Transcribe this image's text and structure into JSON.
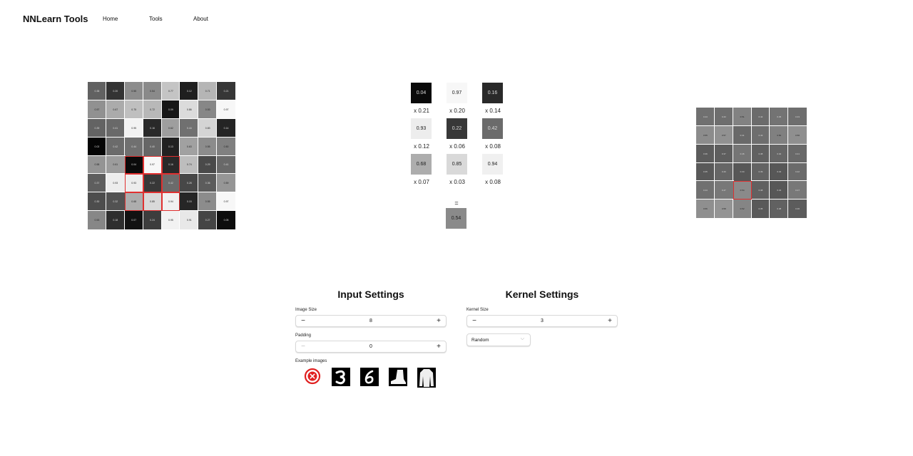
{
  "nav": {
    "brand": "NNLearn Tools",
    "links": [
      "Home",
      "Tools",
      "About"
    ]
  },
  "input_image": {
    "size": 8,
    "values": [
      [
        0.38,
        0.2,
        0.55,
        0.54,
        0.77,
        0.12,
        0.71,
        0.21
      ],
      [
        0.57,
        0.67,
        0.75,
        0.72,
        0.09,
        0.86,
        0.53,
        0.97
      ],
      [
        0.39,
        0.41,
        0.95,
        0.16,
        0.62,
        0.44,
        0.83,
        0.14
      ],
      [
        0.02,
        0.42,
        0.44,
        0.4,
        0.13,
        0.63,
        0.55,
        0.5
      ],
      [
        0.58,
        0.61,
        0.04,
        0.97,
        0.16,
        0.74,
        0.29,
        0.41
      ],
      [
        0.37,
        0.93,
        0.93,
        0.22,
        0.42,
        0.28,
        0.36,
        0.59
      ],
      [
        0.3,
        0.32,
        0.68,
        0.85,
        0.94,
        0.15,
        0.55,
        0.97
      ],
      [
        0.53,
        0.18,
        0.07,
        0.24,
        0.95,
        0.91,
        0.27,
        0.05
      ]
    ],
    "highlight": {
      "row": 4,
      "col": 2,
      "size": 3
    }
  },
  "kernel": {
    "values": [
      [
        0.04,
        0.97,
        0.16
      ],
      [
        0.93,
        0.22,
        0.42
      ],
      [
        0.68,
        0.85,
        0.94
      ]
    ],
    "weights": [
      [
        "x 0.21",
        "x 0.20",
        "x 0.14"
      ],
      [
        "x 0.12",
        "x 0.06",
        "x 0.08"
      ],
      [
        "x 0.07",
        "x 0.03",
        "x 0.08"
      ]
    ],
    "equals": "=",
    "result": 0.54
  },
  "output_image": {
    "size": 6,
    "values": [
      [
        0.44,
        0.43,
        0.51,
        0.42,
        0.45,
        0.43
      ],
      [
        0.55,
        0.57,
        0.41,
        0.43,
        0.5,
        0.56
      ],
      [
        0.36,
        0.37,
        0.46,
        0.38,
        0.4,
        0.41
      ],
      [
        0.35,
        0.4,
        0.34,
        0.39,
        0.34,
        0.42
      ],
      [
        0.44,
        0.47,
        0.54,
        0.38,
        0.34,
        0.47
      ],
      [
        0.56,
        0.58,
        0.52,
        0.35,
        0.38,
        0.36
      ]
    ],
    "highlight": {
      "row": 4,
      "col": 2
    }
  },
  "input_settings": {
    "title": "Input Settings",
    "image_size_label": "Image Size",
    "image_size": "8",
    "padding_label": "Padding",
    "padding": "0",
    "examples_label": "Example images",
    "minus": "−",
    "plus": "+"
  },
  "kernel_settings": {
    "title": "Kernel Settings",
    "kernel_size_label": "Kernel Size",
    "kernel_size": "3",
    "init_selected": "Random",
    "minus": "−",
    "plus": "+"
  },
  "example_icons": [
    "clear-icon",
    "digit-3-icon",
    "digit-6-icon",
    "boot-icon",
    "coat-icon"
  ],
  "colors": {
    "highlight": "#e03030",
    "clear_icon": "#e02020"
  }
}
